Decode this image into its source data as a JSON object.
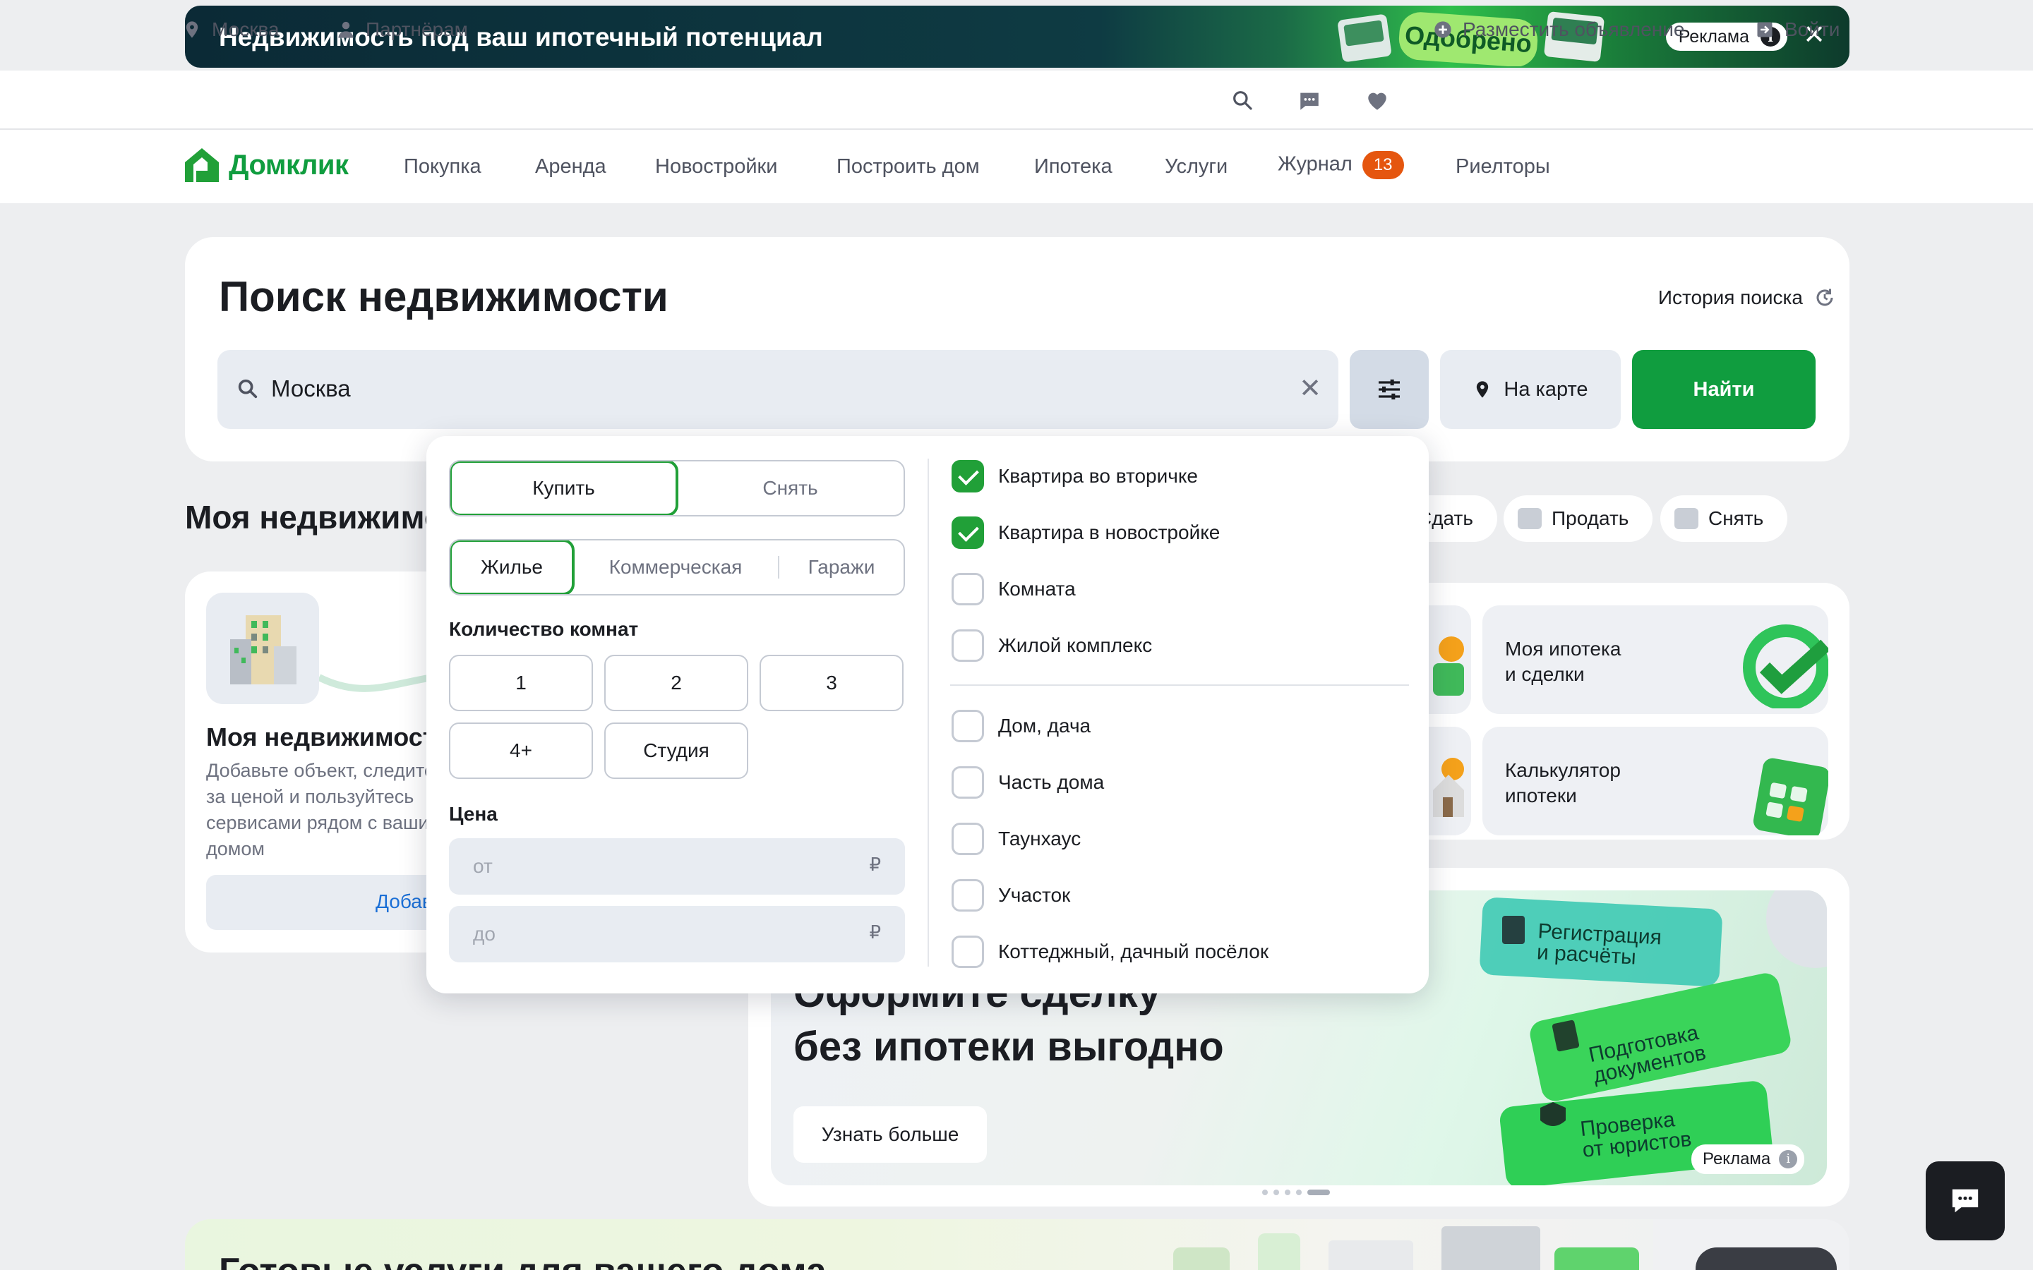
{
  "ad_banner": {
    "title": "Недвижимость под ваш ипотечный потенциал",
    "sticker_text": "Одобрено",
    "label": "Реклама"
  },
  "util_bar": {
    "city": "Москва",
    "partners": "Партнёрам",
    "post_ad": "Разместить объявление",
    "login": "Войти"
  },
  "nav": {
    "logo": "Домклик",
    "items": [
      "Покупка",
      "Аренда",
      "Новостройки",
      "Построить дом",
      "Ипотека",
      "Услуги",
      "Журнал",
      "Риелторы"
    ],
    "journal_badge": "13"
  },
  "search": {
    "title": "Поиск недвижимости",
    "history": "История поиска",
    "value": "Москва",
    "map_button": "На карте",
    "find_button": "Найти"
  },
  "background": {
    "section_title": "Моя недвижимость",
    "chips": [
      "Сдать",
      "Продать",
      "Снять"
    ],
    "my_title": "Моя недвижимость",
    "my_sub": "Добавьте объект, следите за ценой и пользуйтесь сервисами рядом с вашим домом",
    "my_add": "Добавить",
    "tiles": [
      "Моя ипотека\nи сделки",
      "Калькулятор\nипотеки"
    ],
    "promo_title_1": "Оформите сделку",
    "promo_title_2": "без ипотеки выгодно",
    "promo_button": "Узнать больше",
    "promo_ad": "Реклама",
    "promo_tags": [
      "Регистрация\nи расчёты",
      "Подготовка\nдокументов",
      "Проверка\nот юристов"
    ],
    "bottom_title": "Готовые услуги для вашего дома"
  },
  "filter": {
    "deal_tabs": [
      "Купить",
      "Снять"
    ],
    "deal_active": 0,
    "category_tabs": [
      "Жилье",
      "Коммерческая",
      "Гаражи"
    ],
    "category_active": 0,
    "rooms_label": "Количество комнат",
    "rooms": [
      "1",
      "2",
      "3",
      "4+",
      "Студия"
    ],
    "price_label": "Цена",
    "price_from_placeholder": "от",
    "price_to_placeholder": "до",
    "currency": "₽",
    "types_group1": [
      {
        "label": "Квартира во вторичке",
        "checked": true
      },
      {
        "label": "Квартира в новостройке",
        "checked": true
      },
      {
        "label": "Комната",
        "checked": false
      },
      {
        "label": "Жилой комплекс",
        "checked": false
      }
    ],
    "types_group2": [
      {
        "label": "Дом, дача",
        "checked": false
      },
      {
        "label": "Часть дома",
        "checked": false
      },
      {
        "label": "Таунхаус",
        "checked": false
      },
      {
        "label": "Участок",
        "checked": false
      },
      {
        "label": "Коттеджный, дачный посёлок",
        "checked": false
      }
    ]
  },
  "colors": {
    "brand_green": "#109d3f",
    "accent_green": "#21a038",
    "badge_orange": "#e5560f",
    "link_blue": "#1b6fd6"
  }
}
